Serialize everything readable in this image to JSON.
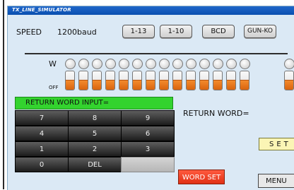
{
  "window": {
    "title": "TX_LINE_SIMULATOR"
  },
  "speed": {
    "label": "SPEED",
    "value": "1200baud"
  },
  "mode_buttons": [
    "1-13",
    "1-10",
    "BCD",
    "GUN-KO"
  ],
  "switch_bank": {
    "w_label": "W",
    "off_label": "OFF"
  },
  "keypad": {
    "header": "RETURN WORD INPUT=",
    "keys": [
      "7",
      "8",
      "9",
      "4",
      "5",
      "6",
      "1",
      "2",
      "3",
      "0",
      "DEL",
      ""
    ]
  },
  "return_word": {
    "label": "RETURN WORD="
  },
  "buttons": {
    "set": "SET",
    "word_set": "WORD SET",
    "menu": "MENU"
  },
  "colors": {
    "accent_orange": "#e8741e",
    "header_green": "#33d32e",
    "word_set_red": "#ef3d1f",
    "set_yellow": "#fbf5b5"
  }
}
